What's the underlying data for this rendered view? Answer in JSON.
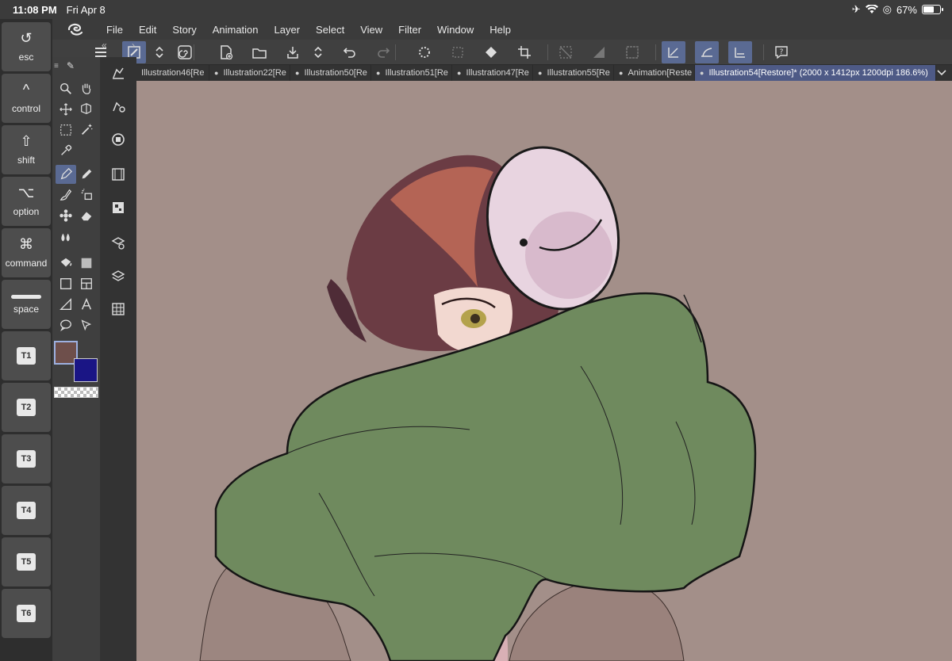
{
  "status": {
    "time": "11:08 PM",
    "date": "Fri Apr 8",
    "battery": "67%",
    "battery_level": 0.67
  },
  "menu": {
    "app_icon": "clip-studio-icon",
    "items": [
      "File",
      "Edit",
      "Story",
      "Animation",
      "Layer",
      "Select",
      "View",
      "Filter",
      "Window",
      "Help"
    ]
  },
  "modifier_keys": [
    {
      "glyph": "↺",
      "label": "esc"
    },
    {
      "glyph": "^",
      "label": "control"
    },
    {
      "glyph": "⇧",
      "label": "shift"
    },
    {
      "glyph": "⌥",
      "label": "option"
    },
    {
      "glyph": "⌘",
      "label": "command"
    },
    {
      "glyph": "",
      "label": "space"
    },
    {
      "badge": "T1"
    },
    {
      "badge": "T2"
    },
    {
      "badge": "T3"
    },
    {
      "badge": "T4"
    },
    {
      "badge": "T5"
    },
    {
      "badge": "T6"
    }
  ],
  "tabs": [
    {
      "label": "Illustration46[Re",
      "active": false
    },
    {
      "label": "Illustration22[Re",
      "active": false
    },
    {
      "label": "Illustration50[Re",
      "active": false
    },
    {
      "label": "Illustration51[Re",
      "active": false
    },
    {
      "label": "Illustration47[Re",
      "active": false
    },
    {
      "label": "Illustration55[Re",
      "active": false
    },
    {
      "label": "Animation[Reste",
      "active": false
    },
    {
      "label": "Illustration54[Restore]* (2000 x 1412px 1200dpi 186.6%)",
      "active": true
    }
  ],
  "colors": {
    "main_color": "#6e4f4b",
    "sub_color": "#1a1585",
    "canvas_bg": "#a38f89",
    "accent": "#5a6a93"
  }
}
